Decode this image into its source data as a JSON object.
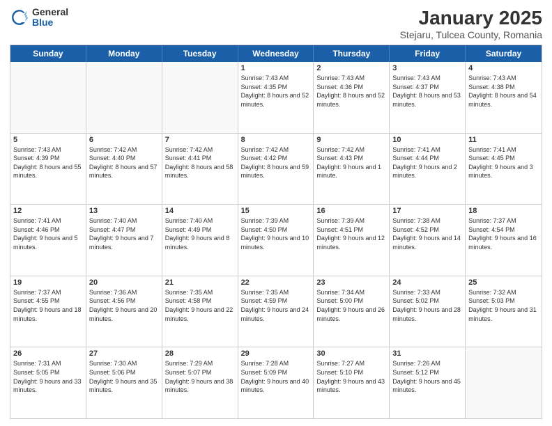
{
  "header": {
    "logo_general": "General",
    "logo_blue": "Blue",
    "title": "January 2025",
    "subtitle": "Stejaru, Tulcea County, Romania"
  },
  "days_of_week": [
    "Sunday",
    "Monday",
    "Tuesday",
    "Wednesday",
    "Thursday",
    "Friday",
    "Saturday"
  ],
  "weeks": [
    [
      {
        "day": "",
        "text": ""
      },
      {
        "day": "",
        "text": ""
      },
      {
        "day": "",
        "text": ""
      },
      {
        "day": "1",
        "text": "Sunrise: 7:43 AM\nSunset: 4:35 PM\nDaylight: 8 hours and 52 minutes."
      },
      {
        "day": "2",
        "text": "Sunrise: 7:43 AM\nSunset: 4:36 PM\nDaylight: 8 hours and 52 minutes."
      },
      {
        "day": "3",
        "text": "Sunrise: 7:43 AM\nSunset: 4:37 PM\nDaylight: 8 hours and 53 minutes."
      },
      {
        "day": "4",
        "text": "Sunrise: 7:43 AM\nSunset: 4:38 PM\nDaylight: 8 hours and 54 minutes."
      }
    ],
    [
      {
        "day": "5",
        "text": "Sunrise: 7:43 AM\nSunset: 4:39 PM\nDaylight: 8 hours and 55 minutes."
      },
      {
        "day": "6",
        "text": "Sunrise: 7:42 AM\nSunset: 4:40 PM\nDaylight: 8 hours and 57 minutes."
      },
      {
        "day": "7",
        "text": "Sunrise: 7:42 AM\nSunset: 4:41 PM\nDaylight: 8 hours and 58 minutes."
      },
      {
        "day": "8",
        "text": "Sunrise: 7:42 AM\nSunset: 4:42 PM\nDaylight: 8 hours and 59 minutes."
      },
      {
        "day": "9",
        "text": "Sunrise: 7:42 AM\nSunset: 4:43 PM\nDaylight: 9 hours and 1 minute."
      },
      {
        "day": "10",
        "text": "Sunrise: 7:41 AM\nSunset: 4:44 PM\nDaylight: 9 hours and 2 minutes."
      },
      {
        "day": "11",
        "text": "Sunrise: 7:41 AM\nSunset: 4:45 PM\nDaylight: 9 hours and 3 minutes."
      }
    ],
    [
      {
        "day": "12",
        "text": "Sunrise: 7:41 AM\nSunset: 4:46 PM\nDaylight: 9 hours and 5 minutes."
      },
      {
        "day": "13",
        "text": "Sunrise: 7:40 AM\nSunset: 4:47 PM\nDaylight: 9 hours and 7 minutes."
      },
      {
        "day": "14",
        "text": "Sunrise: 7:40 AM\nSunset: 4:49 PM\nDaylight: 9 hours and 8 minutes."
      },
      {
        "day": "15",
        "text": "Sunrise: 7:39 AM\nSunset: 4:50 PM\nDaylight: 9 hours and 10 minutes."
      },
      {
        "day": "16",
        "text": "Sunrise: 7:39 AM\nSunset: 4:51 PM\nDaylight: 9 hours and 12 minutes."
      },
      {
        "day": "17",
        "text": "Sunrise: 7:38 AM\nSunset: 4:52 PM\nDaylight: 9 hours and 14 minutes."
      },
      {
        "day": "18",
        "text": "Sunrise: 7:37 AM\nSunset: 4:54 PM\nDaylight: 9 hours and 16 minutes."
      }
    ],
    [
      {
        "day": "19",
        "text": "Sunrise: 7:37 AM\nSunset: 4:55 PM\nDaylight: 9 hours and 18 minutes."
      },
      {
        "day": "20",
        "text": "Sunrise: 7:36 AM\nSunset: 4:56 PM\nDaylight: 9 hours and 20 minutes."
      },
      {
        "day": "21",
        "text": "Sunrise: 7:35 AM\nSunset: 4:58 PM\nDaylight: 9 hours and 22 minutes."
      },
      {
        "day": "22",
        "text": "Sunrise: 7:35 AM\nSunset: 4:59 PM\nDaylight: 9 hours and 24 minutes."
      },
      {
        "day": "23",
        "text": "Sunrise: 7:34 AM\nSunset: 5:00 PM\nDaylight: 9 hours and 26 minutes."
      },
      {
        "day": "24",
        "text": "Sunrise: 7:33 AM\nSunset: 5:02 PM\nDaylight: 9 hours and 28 minutes."
      },
      {
        "day": "25",
        "text": "Sunrise: 7:32 AM\nSunset: 5:03 PM\nDaylight: 9 hours and 31 minutes."
      }
    ],
    [
      {
        "day": "26",
        "text": "Sunrise: 7:31 AM\nSunset: 5:05 PM\nDaylight: 9 hours and 33 minutes."
      },
      {
        "day": "27",
        "text": "Sunrise: 7:30 AM\nSunset: 5:06 PM\nDaylight: 9 hours and 35 minutes."
      },
      {
        "day": "28",
        "text": "Sunrise: 7:29 AM\nSunset: 5:07 PM\nDaylight: 9 hours and 38 minutes."
      },
      {
        "day": "29",
        "text": "Sunrise: 7:28 AM\nSunset: 5:09 PM\nDaylight: 9 hours and 40 minutes."
      },
      {
        "day": "30",
        "text": "Sunrise: 7:27 AM\nSunset: 5:10 PM\nDaylight: 9 hours and 43 minutes."
      },
      {
        "day": "31",
        "text": "Sunrise: 7:26 AM\nSunset: 5:12 PM\nDaylight: 9 hours and 45 minutes."
      },
      {
        "day": "",
        "text": ""
      }
    ]
  ]
}
